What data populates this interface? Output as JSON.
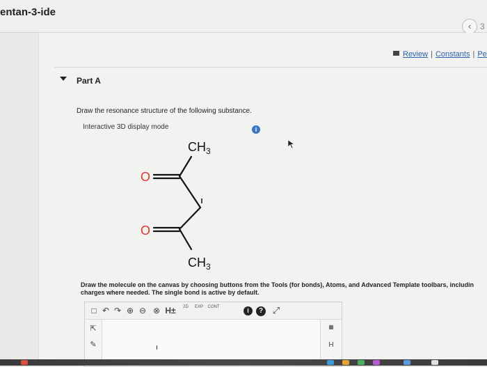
{
  "window": {
    "tab_title": "entan-3-ide",
    "page_count": "3"
  },
  "header": {
    "links": [
      {
        "label": "Review"
      },
      {
        "label": "Constants"
      },
      {
        "label": "Perio"
      }
    ]
  },
  "part": {
    "label": "Part A",
    "question": "Draw the resonance structure of the following substance.",
    "mode_label": "Interactive 3D display mode"
  },
  "molecule": {
    "top_group": "CH",
    "top_sub": "3",
    "bottom_group": "CH",
    "bottom_sub": "3",
    "oxygen_label": "O"
  },
  "instructions": {
    "line1": "Draw the molecule on the canvas by choosing buttons from the Tools (for bonds), Atoms, and Advanced Template toolbars, includin",
    "line2": "charges where needed. The single bond is active by default."
  },
  "editor": {
    "toolbar": {
      "tools": [
        "new-doc",
        "undo",
        "redo",
        "zoom-in",
        "zoom-out",
        "clear",
        "H±",
        "2D",
        "EXP",
        "CONT",
        "info",
        "help",
        "fullscreen"
      ],
      "label_h": "H±",
      "label_2d": "2D",
      "label_exp": "EXP",
      "label_cont": "CONT",
      "label_info": "i",
      "label_help": "?"
    },
    "right_tools": {
      "h_atom": "H"
    }
  },
  "colors": {
    "accent_blue": "#3b74c8",
    "oxygen_red": "#e0352b",
    "link_blue": "#2a62a8"
  }
}
